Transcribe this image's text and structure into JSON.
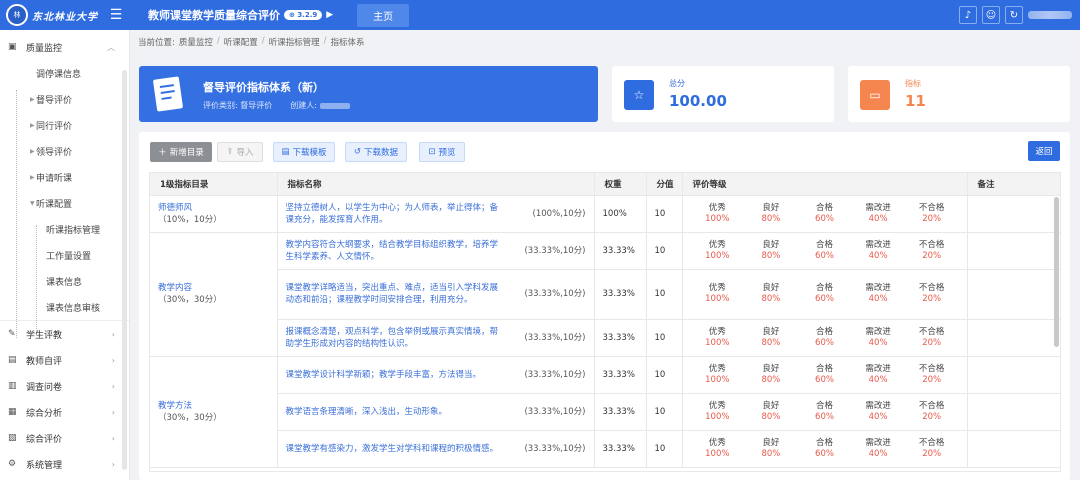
{
  "header": {
    "logo_text": "东北林业大学",
    "title": "教师课堂教学质量综合评价",
    "version": "3.2.9",
    "home_tab": "主页"
  },
  "sidebar": {
    "items": [
      {
        "label": "质量监控",
        "icon": "monitor-icon"
      },
      {
        "label": "学生评教",
        "icon": "edit-icon"
      },
      {
        "label": "教师自评",
        "icon": "id-card-icon"
      },
      {
        "label": "调查问卷",
        "icon": "survey-icon"
      },
      {
        "label": "综合分析",
        "icon": "analysis-icon"
      },
      {
        "label": "综合评价",
        "icon": "evaluation-icon"
      },
      {
        "label": "系统管理",
        "icon": "settings-icon"
      }
    ],
    "subitems": [
      "调停课信息",
      "督导评价",
      "同行评价",
      "领导评价",
      "申请听课",
      "听课配置"
    ],
    "subsubitems": [
      "听课指标管理",
      "工作量设置",
      "课表信息",
      "课表信息审核"
    ]
  },
  "breadcrumb": {
    "prefix": "当前位置:",
    "items": [
      "质量监控",
      "听课配置",
      "听课指标管理",
      "指标体系"
    ]
  },
  "main_card": {
    "title": "督导评价指标体系（新）",
    "type_label": "评价类别: 督导评价",
    "creator_label": "创建人:"
  },
  "stats": {
    "score_label": "总分",
    "score_value": "100.00",
    "index_label": "指标",
    "index_value": "11",
    "score_color": "#2f6ce0",
    "index_color": "#f5864f"
  },
  "toolbar": {
    "add": "新增目录",
    "import": "导入",
    "download_template": "下载模板",
    "download_data": "下载数据",
    "preview": "预览",
    "back": "返回"
  },
  "table": {
    "headers": [
      "1级指标目录",
      "指标名称",
      "权重",
      "分值",
      "评价等级",
      "备注"
    ],
    "grade_names": [
      "优秀",
      "良好",
      "合格",
      "需改进",
      "不合格"
    ],
    "grade_pcts": [
      "100%",
      "80%",
      "60%",
      "40%",
      "20%"
    ],
    "dimensions": [
      {
        "name": "师德师风",
        "detail": "（10%，10分）"
      },
      {
        "name": "教学内容",
        "detail": "（30%，30分）"
      },
      {
        "name": "教学方法",
        "detail": "（30%，30分）"
      }
    ],
    "rows": [
      {
        "text": "坚持立德树人，以学生为中心；为人师表，举止得体；备课充分，能发挥育人作用。",
        "wtxt": "(100%,10分)",
        "weight": "100%",
        "score": "10"
      },
      {
        "text": "教学内容符合大纲要求，结合教学目标组织教学，培养学生科学素养、人文情怀。",
        "wtxt": "(33.33%,10分)",
        "weight": "33.33%",
        "score": "10"
      },
      {
        "text": "课堂教学详略适当，突出重点、难点，适当引入学科发展动态和前沿；课程教学时间安排合理，利用充分。",
        "wtxt": "(33.33%,10分)",
        "weight": "33.33%",
        "score": "10"
      },
      {
        "text": "报课概念清楚，观点科学，包含举例或展示真实情境，帮助学生形成对内容的结构性认识。",
        "wtxt": "(33.33%,10分)",
        "weight": "33.33%",
        "score": "10"
      },
      {
        "text": "课堂教学设计科学新颖；教学手段丰富，方法得当。",
        "wtxt": "(33.33%,10分)",
        "weight": "33.33%",
        "score": "10"
      },
      {
        "text": "教学语言条理清晰，深入浅出，生动形象。",
        "wtxt": "(33.33%,10分)",
        "weight": "33.33%",
        "score": "10"
      },
      {
        "text": "课堂教学有感染力，激发学生对学科和课程的积极情感。",
        "wtxt": "(33.33%,10分)",
        "weight": "33.33%",
        "score": "10"
      }
    ]
  }
}
